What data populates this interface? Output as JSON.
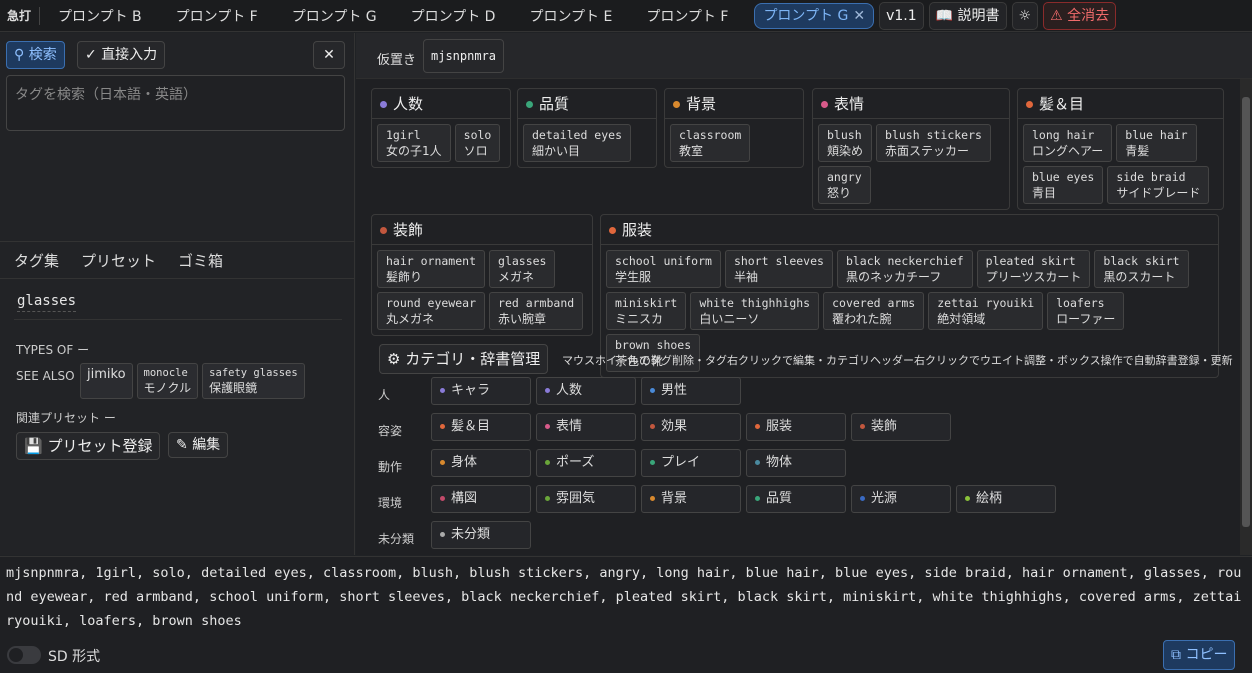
{
  "topbar": {
    "brand": "急打",
    "tabs": [
      "プロンプト B",
      "プロンプト F",
      "プロンプト G",
      "プロンプト D",
      "プロンプト E",
      "プロンプト F"
    ],
    "active_tab": "プロンプト G",
    "version": "v1.1",
    "manual": "説明書",
    "clear_all": "全消去"
  },
  "left": {
    "search_btn": "検索",
    "direct_btn": "直接入力",
    "search_placeholder": "タグを検索（日本語・英語）",
    "subtabs": [
      "タグ集",
      "プリセット",
      "ゴミ箱"
    ],
    "word": "glasses",
    "types_of_label": "TYPES OF",
    "types_of_value": "ー",
    "see_also_label": "SEE ALSO",
    "see_also": [
      {
        "en": "jimiko",
        "ja": ""
      },
      {
        "en": "monocle",
        "ja": "モノクル"
      },
      {
        "en": "safety glasses",
        "ja": "保護眼鏡"
      }
    ],
    "related_label": "関連プリセット",
    "related_value": "ー",
    "preset_register": "プリセット登録",
    "edit": "編集"
  },
  "loose": {
    "label": "仮置き",
    "tag": "mjsnpnmra"
  },
  "groups": [
    {
      "title": "人数",
      "color": "#8a7bd8",
      "tags": [
        {
          "en": "1girl",
          "ja": "女の子1人"
        },
        {
          "en": "solo",
          "ja": "ソロ"
        }
      ]
    },
    {
      "title": "品質",
      "color": "#3aa67a",
      "tags": [
        {
          "en": "detailed eyes",
          "ja": "細かい目"
        }
      ]
    },
    {
      "title": "背景",
      "color": "#d8892e",
      "tags": [
        {
          "en": "classroom",
          "ja": "教室"
        }
      ]
    },
    {
      "title": "表情",
      "color": "#d85a8a",
      "tags": [
        {
          "en": "blush",
          "ja": "頬染め"
        },
        {
          "en": "blush stickers",
          "ja": "赤面ステッカー"
        },
        {
          "en": "angry",
          "ja": "怒り"
        }
      ]
    },
    {
      "title": "髪＆目",
      "color": "#e0673c",
      "tags": [
        {
          "en": "long hair",
          "ja": "ロングヘアー"
        },
        {
          "en": "blue hair",
          "ja": "青髪"
        },
        {
          "en": "blue eyes",
          "ja": "青目"
        },
        {
          "en": "side braid",
          "ja": "サイドブレード"
        }
      ]
    },
    {
      "title": "装飾",
      "color": "#c2573e",
      "tags": [
        {
          "en": "hair ornament",
          "ja": "髪飾り"
        },
        {
          "en": "glasses",
          "ja": "メガネ"
        },
        {
          "en": "round eyewear",
          "ja": "丸メガネ"
        },
        {
          "en": "red armband",
          "ja": "赤い腕章"
        }
      ]
    },
    {
      "title": "服装",
      "color": "#e0673c",
      "tags": [
        {
          "en": "school uniform",
          "ja": "学生服"
        },
        {
          "en": "short sleeves",
          "ja": "半袖"
        },
        {
          "en": "black neckerchief",
          "ja": "黒のネッカチーフ"
        },
        {
          "en": "pleated skirt",
          "ja": "プリーツスカート"
        },
        {
          "en": "black skirt",
          "ja": "黒のスカート"
        },
        {
          "en": "miniskirt",
          "ja": "ミニスカ"
        },
        {
          "en": "white thighhighs",
          "ja": "白いニーソ"
        },
        {
          "en": "covered arms",
          "ja": "覆われた腕"
        },
        {
          "en": "zettai ryouiki",
          "ja": "絶対領域"
        },
        {
          "en": "loafers",
          "ja": "ローファー"
        },
        {
          "en": "brown shoes",
          "ja": "茶色の靴"
        }
      ]
    }
  ],
  "manage": {
    "btn": "カテゴリ・辞書管理",
    "hint": "マウスホイールでタグ削除・タグ右クリックで編集・カテゴリヘッダー右クリックでウエイト調整・ボックス操作で自動辞書登録・更新"
  },
  "categories": [
    {
      "label": "人",
      "items": [
        {
          "name": "キャラ",
          "color": "#8a7bd8"
        },
        {
          "name": "人数",
          "color": "#8a7bd8"
        },
        {
          "name": "男性",
          "color": "#4a8ad8"
        }
      ]
    },
    {
      "label": "容姿",
      "items": [
        {
          "name": "髪＆目",
          "color": "#e0673c"
        },
        {
          "name": "表情",
          "color": "#d85a8a"
        },
        {
          "name": "効果",
          "color": "#c2573e"
        },
        {
          "name": "服装",
          "color": "#e0673c"
        },
        {
          "name": "装飾",
          "color": "#c2573e"
        }
      ]
    },
    {
      "label": "動作",
      "items": [
        {
          "name": "身体",
          "color": "#d8892e"
        },
        {
          "name": "ポーズ",
          "color": "#6aa63a"
        },
        {
          "name": "プレイ",
          "color": "#3aa67a"
        },
        {
          "name": "物体",
          "color": "#4a8aa0"
        }
      ]
    },
    {
      "label": "環境",
      "items": [
        {
          "name": "構図",
          "color": "#c24a6a"
        },
        {
          "name": "雰囲気",
          "color": "#6aa63a"
        },
        {
          "name": "背景",
          "color": "#d8892e"
        },
        {
          "name": "品質",
          "color": "#3aa67a"
        },
        {
          "name": "光源",
          "color": "#3a6ac2"
        },
        {
          "name": "絵柄",
          "color": "#8ac23a"
        }
      ]
    },
    {
      "label": "未分類",
      "items": [
        {
          "name": "未分類",
          "color": "#aaaaaa"
        }
      ]
    }
  ],
  "output": {
    "text": "mjsnpnmra, 1girl, solo, detailed eyes, classroom, blush, blush stickers, angry, long hair, blue hair, blue eyes, side braid, hair ornament, glasses, round eyewear, red armband, school uniform, short sleeves, black neckerchief, pleated skirt, black skirt, miniskirt, white thighhighs, covered arms, zettai ryouiki, loafers, brown shoes",
    "sd_label": "SD 形式",
    "copy": "コピー"
  }
}
